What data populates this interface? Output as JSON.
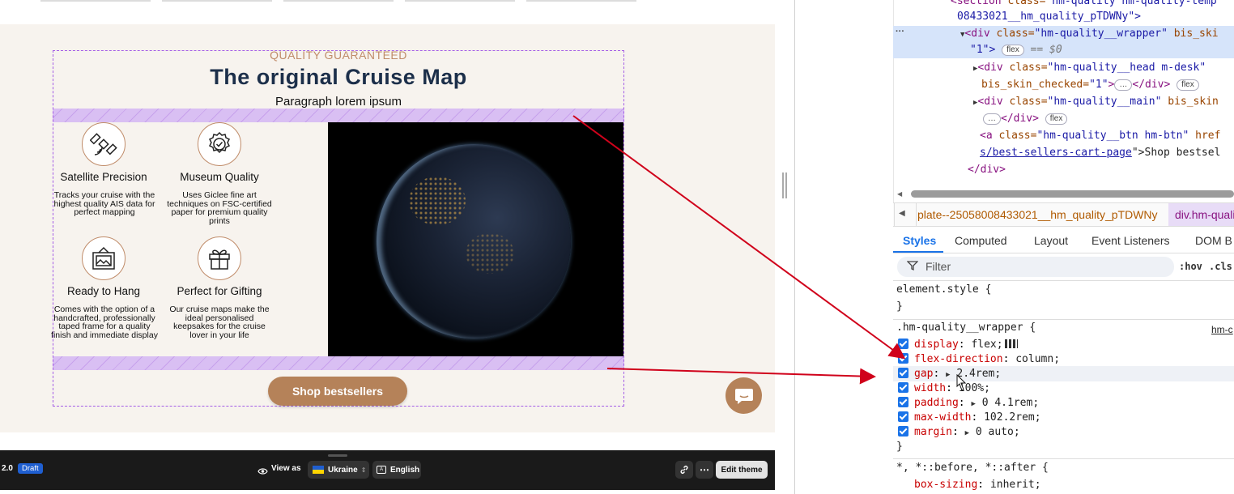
{
  "preview": {
    "eyebrow": "QUALITY GUARANTEED",
    "title": "The original Cruise Map",
    "paragraph": "Paragraph lorem ipsum",
    "features": [
      {
        "icon": "satellite-icon",
        "title": "Satellite Precision",
        "desc": "Tracks your cruise with the highest quality AIS data for perfect mapping"
      },
      {
        "icon": "badge-icon",
        "title": "Museum Quality",
        "desc": "Uses Giclee fine art techniques on FSC-certified paper for premium quality prints"
      },
      {
        "icon": "framed-picture-icon",
        "title": "Ready to Hang",
        "desc": "Comes with the option of a handcrafted, professionally taped frame for a quality finish and immediate display"
      },
      {
        "icon": "gift-icon",
        "title": "Perfect for Gifting",
        "desc": "Our cruise maps make the ideal personalised keepsakes for the cruise lover in your life"
      }
    ],
    "button": "Shop bestsellers"
  },
  "bottom_bar": {
    "version": "2.0",
    "status": "Draft",
    "view_as": "View as",
    "country": "Ukraine",
    "language": "English",
    "edit": "Edit theme"
  },
  "devtools": {
    "dom": {
      "line1_tag": "<section",
      "line1_attr": " class=",
      "line1_val": "\"hm-quality hm-quality-temp",
      "line2": "08433021__hm_quality_pTDWNy\">",
      "selected_open": "<div",
      "selected_attr": " class=",
      "selected_val": "\"hm-quality__wrapper\"",
      "selected_attr2": " bis_ski",
      "selected_line2": "\"1\">",
      "selected_badge": "flex",
      "selected_ref": "== $0",
      "head_tag": "<div",
      "head_attr": " class=",
      "head_val": "\"hm-quality__head m-desk\"",
      "head_line2_attr": "bis_skin_checked=",
      "head_line2_val": "\"1\"",
      "head_close": "</div>",
      "head_badge": "flex",
      "main_tag": "<div",
      "main_attr": " class=",
      "main_val": "\"hm-quality__main\"",
      "main_attr2": " bis_skin",
      "main_close": "</div>",
      "main_badge": "flex",
      "a_tag": "<a",
      "a_attr": " class=",
      "a_val": "\"hm-quality__btn hm-btn\"",
      "a_attr2": " href",
      "a_link": "s/best-sellers-cart-page",
      "a_text": "\">Shop bestsel",
      "div_close": "</div>",
      "ellipsis": "…"
    },
    "breadcrumb": {
      "left": "plate--25058008433021__hm_quality_pTDWNy",
      "right": "div.hm-quality"
    },
    "tabs": [
      "Styles",
      "Computed",
      "Layout",
      "Event Listeners",
      "DOM B"
    ],
    "filter_placeholder": "Filter",
    "hov": ":hov",
    "cls": ".cls",
    "element_style": "element.style {",
    "close_brace": "}",
    "rule_selector": ".hm-quality__wrapper {",
    "rule_source": "hm-c",
    "declarations": [
      {
        "prop": "display",
        "value": "flex;"
      },
      {
        "prop": "flex-direction",
        "value": "column;"
      },
      {
        "prop": "gap",
        "value": "2.4rem;"
      },
      {
        "prop": "width",
        "value": "100%;"
      },
      {
        "prop": "padding",
        "value": "0 4.1rem;"
      },
      {
        "prop": "max-width",
        "value": "102.2rem;"
      },
      {
        "prop": "margin",
        "value": "0 auto;"
      }
    ],
    "universal_selector": "*, *::before, *::after {",
    "box_sizing": {
      "prop": "box-sizing",
      "value": "inherit;"
    }
  }
}
